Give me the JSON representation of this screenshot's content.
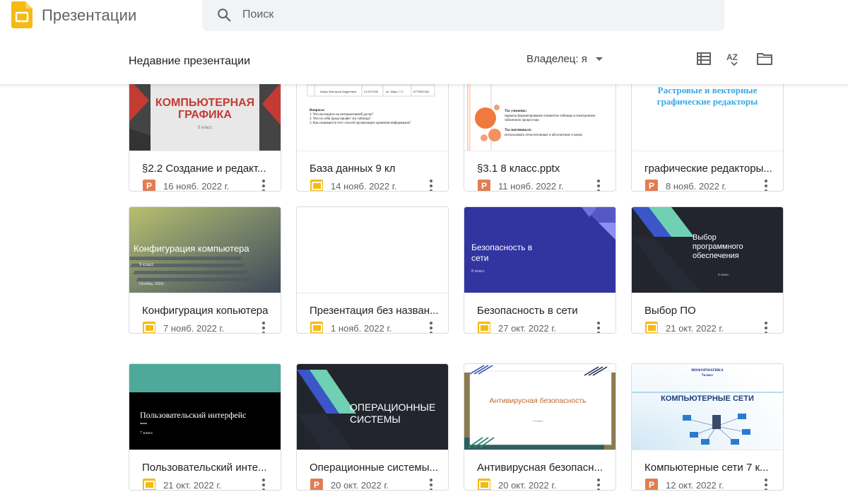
{
  "header": {
    "app_title": "Презентации",
    "search_placeholder": "Поиск"
  },
  "toolbar": {
    "section_title": "Недавние презентации",
    "owner_filter": "Владелец: я",
    "sort_icon_label": "AZ"
  },
  "colors": {
    "slides_brand": "#f5ba14",
    "pptx_badge": "#e27d51"
  },
  "files": [
    {
      "name": "§2.2 Создание и редакт...",
      "date": "16 нояб. 2022 г.",
      "type": "pptx",
      "type_letter": "P",
      "thumb": {
        "title1": "КОМПЬЮТЕРНАЯ",
        "title2": "ГРАФИКА",
        "sub": "5 класс"
      }
    },
    {
      "name": "База данных 9 кл",
      "date": "14 нояб. 2022 г.",
      "type": "slides",
      "thumb": {
        "cell1": "Асмус Виктория Андреевна",
        "cell2": "01.03.2005",
        "cell3": "ул. Мира, 7-3",
        "cell4": "8779532434",
        "q0": "Вопросы:",
        "q1": "1. Что вы видите на интерактивной доске?",
        "q2": "2. Что из себя представляет эта таблица?",
        "q3": "3. Как называется этот способ организации хранения информации?"
      }
    },
    {
      "name": "§3.1 8 класс.pptx",
      "date": "11 нояб. 2022 г.",
      "type": "pptx",
      "type_letter": "P",
      "thumb": {
        "l1": "Ты узнаешь:",
        "l2": "правила форматирования элементов таблицы в электронном",
        "l3": "табличном процессоре.",
        "l4": "Ты научишься:",
        "l5": "использовать относительные и абсолютные ссылки;"
      }
    },
    {
      "name": "графические редакторы...",
      "date": "8 нояб. 2022 г.",
      "type": "pptx",
      "type_letter": "P",
      "thumb": {
        "l1": "Растровые и векторные",
        "l2": "графические редакторы"
      }
    },
    {
      "name": "Конфигурация копьютера",
      "date": "7 нояб. 2022 г.",
      "type": "slides",
      "thumb": {
        "title": "Конфигурация компьютера",
        "sub": "9 класс",
        "date": "Октябрь, 2022г."
      }
    },
    {
      "name": "Презентация без назван...",
      "date": "1 нояб. 2022 г.",
      "type": "slides",
      "thumb": {}
    },
    {
      "name": "Безопасность в сети",
      "date": "27 окт. 2022 г.",
      "type": "slides",
      "thumb": {
        "l1": "Безопасность в",
        "l2": "сети",
        "sub": "8 класс"
      }
    },
    {
      "name": "Выбор ПО",
      "date": "21 окт. 2022 г.",
      "type": "slides",
      "thumb": {
        "l1": "Выбор",
        "l2": "программного",
        "l3": "обеспечения",
        "sub": "9 класс"
      }
    },
    {
      "name": "Пользовательский инте...",
      "date": "21 окт. 2022 г.",
      "type": "slides",
      "thumb": {
        "title": "Пользовательский интерфейс",
        "sub": "7 класс"
      }
    },
    {
      "name": "Операционные системы...",
      "date": "20 окт. 2022 г.",
      "type": "pptx",
      "type_letter": "P",
      "thumb": {
        "l1": "ОПЕРАЦИОННЫЕ",
        "l2": "СИСТЕМЫ"
      }
    },
    {
      "name": "Антивирусная безопасн...",
      "date": "20 окт. 2022 г.",
      "type": "slides",
      "thumb": {
        "title": "Антивирусная безопасность",
        "sub": "7 класс"
      }
    },
    {
      "name": "Компьютерные сети 7 к...",
      "date": "12 окт. 2022 г.",
      "type": "pptx",
      "type_letter": "P",
      "thumb": {
        "l1": "ИНФОРМАТИКА",
        "l2": "7класс",
        "title": "КОМПЬЮТЕРНЫЕ СЕТИ"
      }
    }
  ]
}
